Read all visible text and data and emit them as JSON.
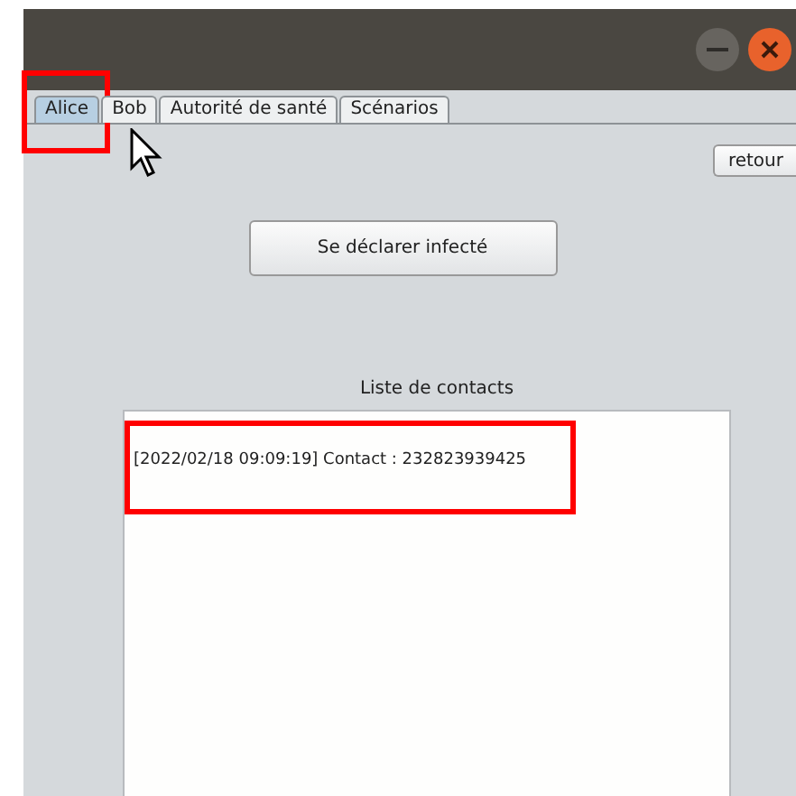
{
  "tabs": [
    {
      "label": "Alice",
      "selected": true,
      "highlighted": true
    },
    {
      "label": "Bob",
      "selected": false,
      "highlighted": false
    },
    {
      "label": "Autorité de santé",
      "selected": false,
      "highlighted": false
    },
    {
      "label": "Scénarios",
      "selected": false,
      "highlighted": false
    }
  ],
  "back_button": "retour",
  "declare_button": "Se déclarer infecté",
  "contacts": {
    "title": "Liste de contacts",
    "items": [
      {
        "text": "[2022/02/18 09:09:19] Contact : 232823939425",
        "highlighted": true
      }
    ]
  }
}
